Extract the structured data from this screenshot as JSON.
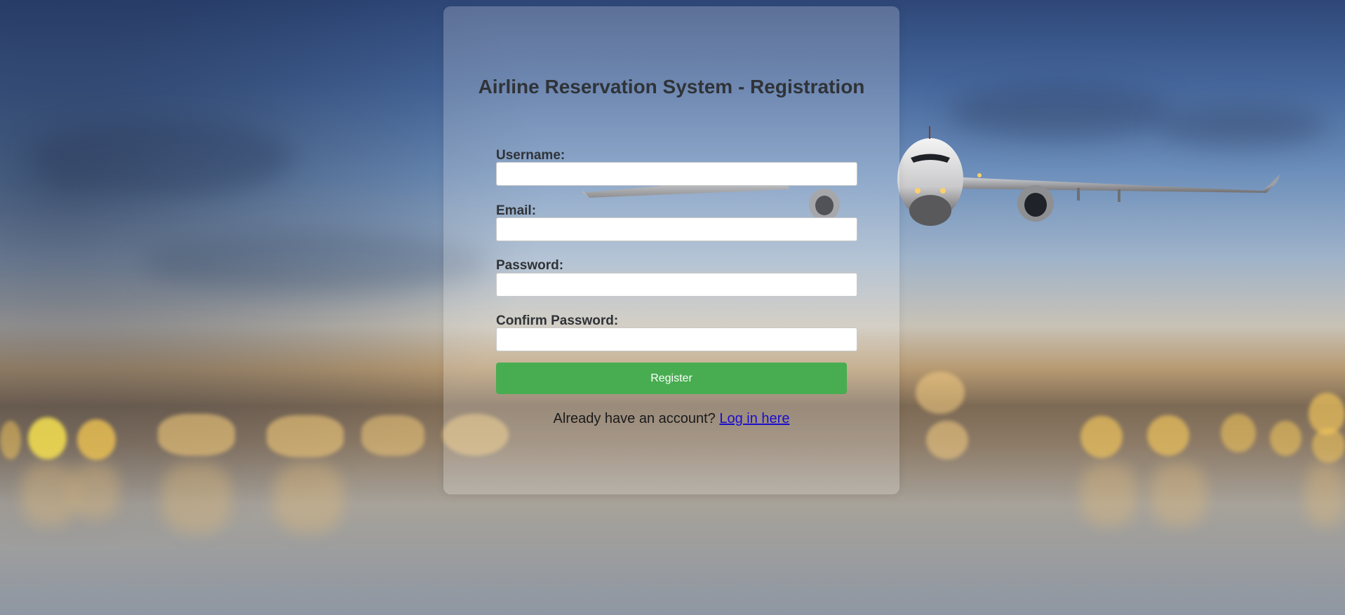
{
  "form": {
    "title": "Airline Reservation System - Registration",
    "fields": [
      {
        "label": "Username:",
        "type": "text",
        "value": ""
      },
      {
        "label": "Email:",
        "type": "email",
        "value": ""
      },
      {
        "label": "Password:",
        "type": "password",
        "value": ""
      },
      {
        "label": "Confirm Password:",
        "type": "password",
        "value": ""
      }
    ],
    "register_label": "Register",
    "footer_text": "Already have an account?",
    "login_link": "Log in here"
  },
  "colors": {
    "register_button": "#48ad51",
    "link": "#1a0dcc",
    "text": "#2f3338"
  }
}
